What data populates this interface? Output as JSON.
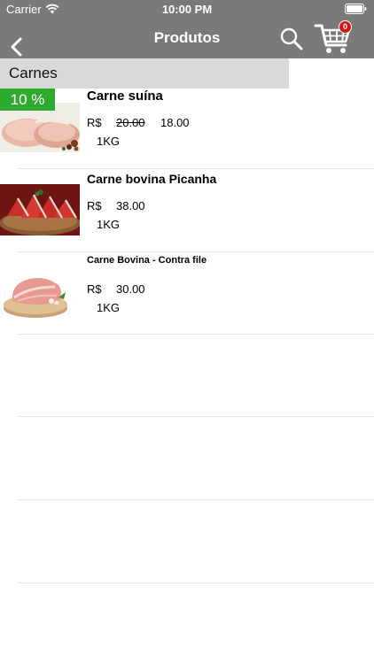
{
  "status_bar": {
    "carrier": "Carrier",
    "time": "10:00 PM",
    "wifi_icon": "wifi-icon",
    "battery_icon": "battery-icon"
  },
  "nav": {
    "title": "Produtos",
    "back_icon": "chevron-left-icon",
    "search_icon": "search-icon",
    "cart_icon": "cart-icon",
    "cart_count": "0",
    "bar_color": "#7a7a7a",
    "badge_color": "#d31414"
  },
  "category": {
    "label": "Carnes",
    "bar_color": "#d9d9d9"
  },
  "products": [
    {
      "name": "Carne suína",
      "currency": "R$",
      "old_price": "20.00",
      "price": "18.00",
      "unit": "1KG",
      "discount": "10 %",
      "discount_color": "#2eaa2e"
    },
    {
      "name": "Carne bovina Picanha",
      "currency": "R$",
      "price": "38.00",
      "unit": "1KG"
    },
    {
      "name": "Carne Bovina - Contra file",
      "currency": "R$",
      "price": "30.00",
      "unit": "1KG"
    }
  ]
}
